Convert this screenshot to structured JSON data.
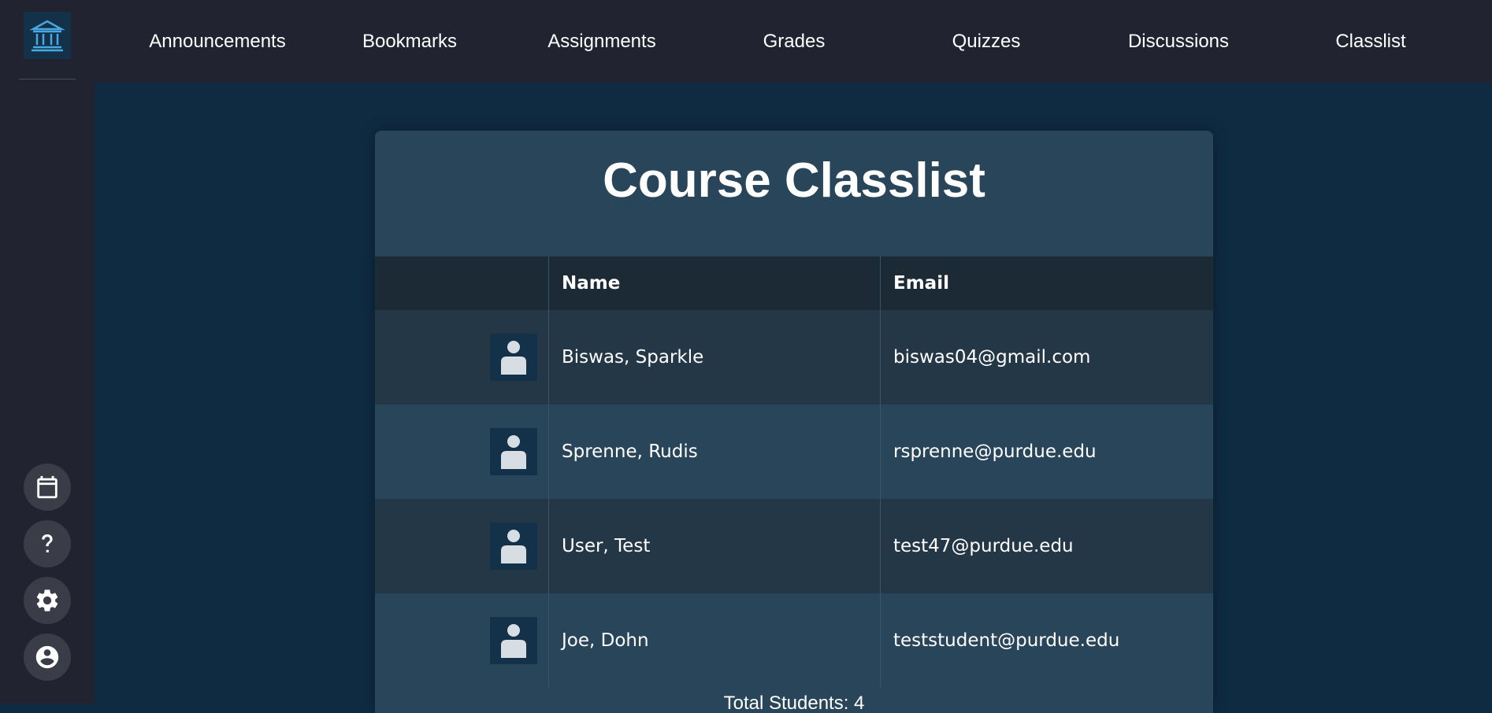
{
  "nav": {
    "items": [
      {
        "label": "Announcements"
      },
      {
        "label": "Bookmarks"
      },
      {
        "label": "Assignments"
      },
      {
        "label": "Grades"
      },
      {
        "label": "Quizzes"
      },
      {
        "label": "Discussions"
      },
      {
        "label": "Classlist"
      }
    ]
  },
  "sidebar": {
    "logo_icon": "institution-icon",
    "buttons": [
      {
        "icon": "calendar-icon"
      },
      {
        "icon": "help-icon"
      },
      {
        "icon": "gear-icon"
      },
      {
        "icon": "account-icon"
      }
    ]
  },
  "classlist": {
    "title": "Course Classlist",
    "columns": {
      "name": "Name",
      "email": "Email"
    },
    "students": [
      {
        "name": "Biswas, Sparkle",
        "email": "biswas04@gmail.com"
      },
      {
        "name": "Sprenne, Rudis",
        "email": "rsprenne@purdue.edu"
      },
      {
        "name": "User, Test",
        "email": "test47@purdue.edu"
      },
      {
        "name": "Joe, Dohn",
        "email": "teststudent@purdue.edu"
      }
    ],
    "total_label": "Total Students: 4"
  },
  "colors": {
    "sidebar_bg": "#212330",
    "page_bg": "#0f2b42",
    "card_bg": "#284559",
    "header_bg": "#1c2a36",
    "accent": "#4aa8e0"
  }
}
